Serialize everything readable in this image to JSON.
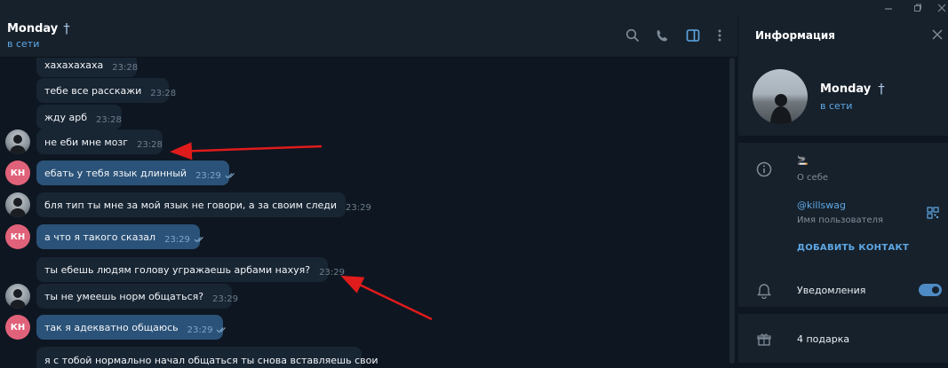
{
  "chat": {
    "name": "Monday",
    "name_symbol": "†",
    "status": "в сети"
  },
  "messages": [
    {
      "text": "хахахахаха",
      "time": "23:28",
      "type": "in",
      "avatar": null
    },
    {
      "text": "тебе все расскажи",
      "time": "23:28",
      "type": "in",
      "avatar": null
    },
    {
      "text": "жду арб",
      "time": "23:28",
      "type": "in",
      "avatar": null
    },
    {
      "text": "не еби мне мозг",
      "time": "23:28",
      "type": "in",
      "avatar": "photo"
    },
    {
      "text": "ебать у тебя язык длинный",
      "time": "23:29",
      "type": "out",
      "avatar": "КН"
    },
    {
      "text": "бля тип ты мне за мой язык не говори, а за своим следи",
      "time": "23:29",
      "type": "in",
      "avatar": "photo"
    },
    {
      "text": "а что я такого сказал",
      "time": "23:29",
      "type": "out",
      "avatar": "КН"
    },
    {
      "text": "ты ебешь людям голову угражаешь арбами нахуя?",
      "time": "23:29",
      "type": "in",
      "avatar": null
    },
    {
      "text": "ты не умеешь норм общаться?",
      "time": "23:29",
      "type": "in",
      "avatar": "photo"
    },
    {
      "text": "так я адекватно общаюсь",
      "time": "23:29",
      "type": "out",
      "avatar": "КН"
    },
    {
      "text": "я с тобой нормально начал общаться ты снова вставляешь свои",
      "time": "",
      "type": "in",
      "avatar": null
    }
  ],
  "info_panel": {
    "title": "Информация",
    "name": "Monday",
    "name_symbol": "†",
    "status": "в сети",
    "bio_emoji": "🚬",
    "bio_label": "О себе",
    "username": "@killswag",
    "username_label": "Имя пользователя",
    "add_contact": "ДОБАВИТЬ КОНТАКТ",
    "notifications_label": "Уведомления",
    "notifications_on": true,
    "gifts_label": "4 подарка"
  },
  "colors": {
    "background": "#0e1621",
    "panel": "#17212b",
    "incoming_bubble": "#182533",
    "outgoing_bubble": "#2b5278",
    "accent": "#5ea8e6",
    "avatar_kh": "#e0627a",
    "arrow": "#e01b1b"
  },
  "icons": [
    "minimize-icon",
    "maximize-icon",
    "close-icon",
    "search-icon",
    "phone-icon",
    "sidebar-toggle-icon",
    "more-icon",
    "info-icon",
    "qr-code-icon",
    "bell-icon",
    "gift-icon",
    "double-check-icon"
  ]
}
